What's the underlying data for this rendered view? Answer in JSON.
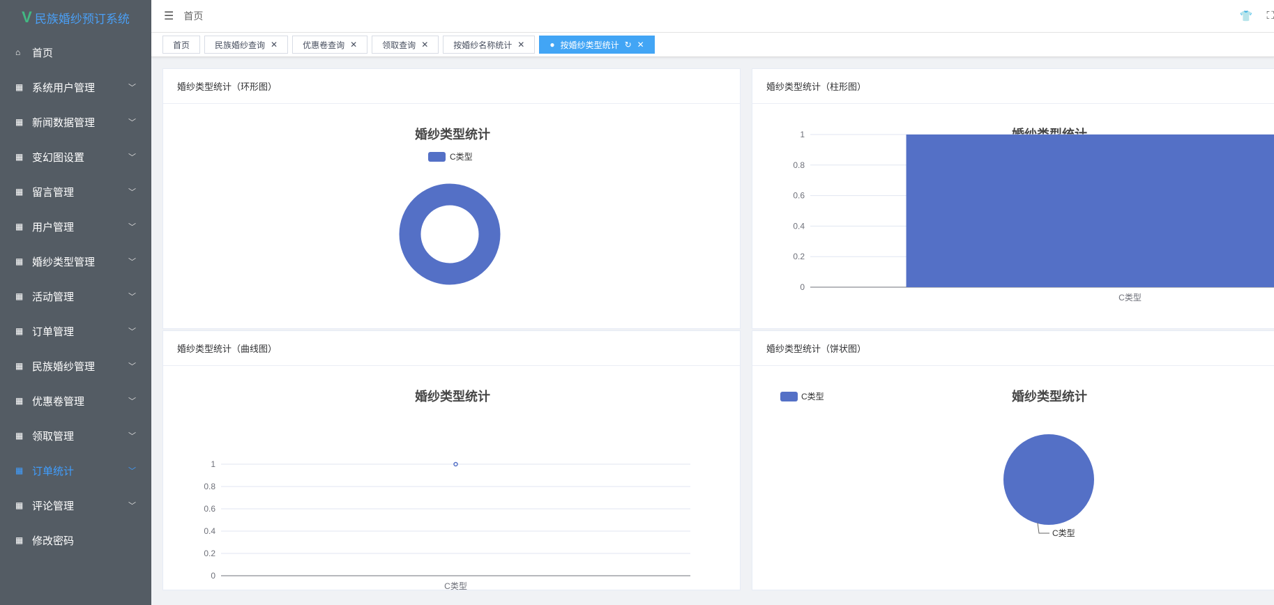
{
  "app": {
    "title": "民族婚纱预订系统"
  },
  "sidebar": {
    "items": [
      {
        "label": "首页",
        "icon": "home-icon",
        "chevron": false
      },
      {
        "label": "系统用户管理",
        "icon": "grid-icon",
        "chevron": true
      },
      {
        "label": "新闻数据管理",
        "icon": "grid-icon",
        "chevron": true
      },
      {
        "label": "变幻图设置",
        "icon": "grid-icon",
        "chevron": true
      },
      {
        "label": "留言管理",
        "icon": "grid-icon",
        "chevron": true
      },
      {
        "label": "用户管理",
        "icon": "grid-icon",
        "chevron": true
      },
      {
        "label": "婚纱类型管理",
        "icon": "grid-icon",
        "chevron": true
      },
      {
        "label": "活动管理",
        "icon": "grid-icon",
        "chevron": true
      },
      {
        "label": "订单管理",
        "icon": "grid-icon",
        "chevron": true
      },
      {
        "label": "民族婚纱管理",
        "icon": "grid-icon",
        "chevron": true
      },
      {
        "label": "优惠卷管理",
        "icon": "grid-icon",
        "chevron": true
      },
      {
        "label": "领取管理",
        "icon": "grid-icon",
        "chevron": true
      },
      {
        "label": "订单统计",
        "icon": "grid-icon",
        "chevron": true,
        "active": true
      },
      {
        "label": "评论管理",
        "icon": "grid-icon",
        "chevron": true
      },
      {
        "label": "修改密码",
        "icon": "grid-icon",
        "chevron": false
      }
    ]
  },
  "header": {
    "breadcrumb": "首页"
  },
  "tabs": [
    {
      "label": "首页",
      "closable": false
    },
    {
      "label": "民族婚纱查询",
      "closable": true
    },
    {
      "label": "优惠卷查询",
      "closable": true
    },
    {
      "label": "领取查询",
      "closable": true
    },
    {
      "label": "按婚纱名称统计",
      "closable": true
    },
    {
      "label": "按婚纱类型统计",
      "closable": true,
      "active": true
    }
  ],
  "colors": {
    "series": "#5470c6",
    "accent": "#409eff"
  },
  "cards": {
    "ring": "婚纱类型统计（环形图）",
    "bar": "婚纱类型统计（柱形图）",
    "line": "婚纱类型统计（曲线图）",
    "pie": "婚纱类型统计（饼状图）"
  },
  "chart_data": [
    {
      "type": "pie",
      "variant": "ring",
      "title": "婚纱类型统计",
      "legend": [
        "C类型"
      ],
      "categories": [
        "C类型"
      ],
      "values": [
        1
      ]
    },
    {
      "type": "bar",
      "title": "婚纱类型统计",
      "categories": [
        "C类型"
      ],
      "values": [
        1
      ],
      "yticks": [
        "0",
        "0.2",
        "0.4",
        "0.6",
        "0.8",
        "1"
      ],
      "ylim": [
        0,
        1
      ]
    },
    {
      "type": "line",
      "title": "婚纱类型统计",
      "categories": [
        "C类型"
      ],
      "values": [
        1
      ],
      "yticks": [
        "0",
        "0.2",
        "0.4",
        "0.6",
        "0.8",
        "1"
      ],
      "ylim": [
        0,
        1
      ]
    },
    {
      "type": "pie",
      "title": "婚纱类型统计",
      "legend": [
        "C类型"
      ],
      "categories": [
        "C类型"
      ],
      "values": [
        1
      ]
    }
  ]
}
